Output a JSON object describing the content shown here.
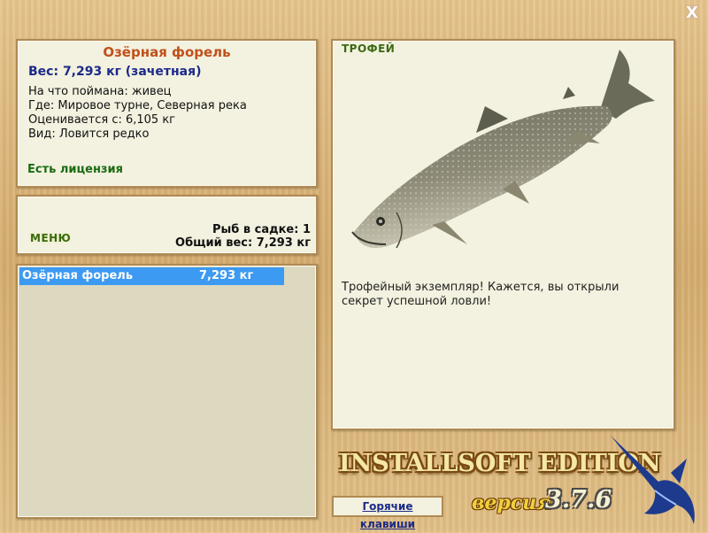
{
  "window": {
    "close_label": "X"
  },
  "fish_info": {
    "name": "Озёрная форель",
    "weight": "Вес: 7,293 кг (зачетная)",
    "caught_on": "На что поймана: живец",
    "where": "Где: Мировое турне, Северная река",
    "rated_from": "Оценивается с: 6,105 кг",
    "kind": "Вид: Ловится редко",
    "license": "Есть лицензия"
  },
  "menu_panel": {
    "menu_label": "МЕНЮ",
    "fish_in_keepnet": "Рыб в садке: 1",
    "total_weight": "Общий вес: 7,293 кг"
  },
  "catch_list": [
    {
      "name": "Озёрная форель",
      "weight": "7,293 кг"
    }
  ],
  "trophy": {
    "title": "ТРОФЕЙ",
    "description": "Трофейный экземпляр! Кажется, вы открыли секрет успешной ловли!"
  },
  "hotkeys_label": "Горячие клавиши",
  "logo": {
    "text": "INSTALLSOFT EDITION",
    "version_word": "версия",
    "version_number": "3.7.6"
  },
  "colors": {
    "selection": "#3d9af2",
    "fish_name": "#c0501a",
    "weight_text": "#1b2a8a",
    "license_text": "#1a6b12"
  }
}
